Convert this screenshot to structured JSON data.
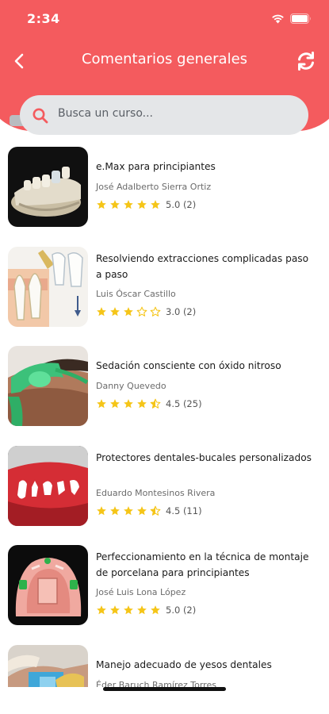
{
  "status_bar": {
    "time": "2:34",
    "icons": [
      "wifi-icon",
      "battery-icon"
    ]
  },
  "header": {
    "title": "Comentarios generales",
    "back_icon": "chevron-left-icon",
    "refresh_icon": "refresh-icon",
    "color": "#f45b5e"
  },
  "search": {
    "placeholder": "Busca un curso..."
  },
  "courses": [
    {
      "title": "e.Max para principiantes",
      "author": "José Adalberto Sierra Ortiz",
      "rating": 5.0,
      "rating_label": "5.0 (2)",
      "thumb_icon": "dental-model-image"
    },
    {
      "title": "Resolviendo extracciones complicadas paso a paso",
      "author": "Luis Óscar Castillo",
      "rating": 3.0,
      "rating_label": "3.0 (2)",
      "thumb_icon": "tooth-extraction-diagram-image"
    },
    {
      "title": "Sedación consciente con óxido nitroso",
      "author": "Danny Quevedo",
      "rating": 4.5,
      "rating_label": "4.5 (25)",
      "thumb_icon": "nasal-mask-image"
    },
    {
      "title": "Protectores dentales-bucales personalizados",
      "author": "Eduardo Montesinos Rivera",
      "rating": 4.5,
      "rating_label": "4.5 (11)",
      "thumb_icon": "mouthguard-image"
    },
    {
      "title": "Perfeccionamiento en la técnica de montaje de porcelana para principiantes",
      "author": "José Luis Lona López",
      "rating": 5.0,
      "rating_label": "5.0 (2)",
      "thumb_icon": "porcelain-model-image"
    },
    {
      "title": "Manejo adecuado de yesos dentales",
      "author": "Éder Baruch Ramírez Torres",
      "rating": null,
      "rating_label": "",
      "thumb_icon": "dental-plaster-image"
    }
  ],
  "colors": {
    "star": "#f5c518",
    "star_empty": "#f5c518",
    "accent": "#f45b5e"
  }
}
